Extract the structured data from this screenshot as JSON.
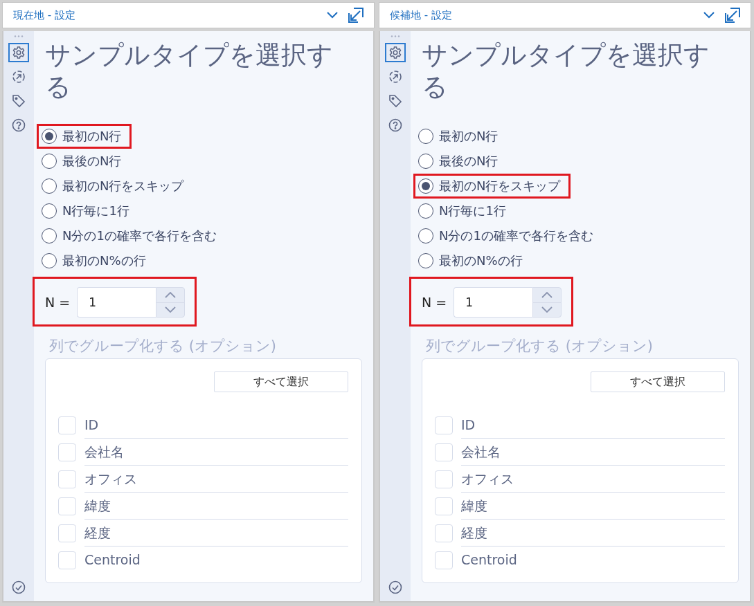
{
  "panels": [
    {
      "title": "現在地 - 設定",
      "tools": [
        {
          "kind": "settings",
          "selected": true
        },
        {
          "kind": "connection",
          "selected": false
        },
        {
          "kind": "tag",
          "selected": false
        },
        {
          "kind": "help",
          "selected": false
        }
      ],
      "heading": "サンプルタイプを選択する",
      "options": [
        {
          "label": "最初のN行",
          "selected": true,
          "highlighted": true
        },
        {
          "label": "最後のN行",
          "selected": false,
          "highlighted": false
        },
        {
          "label": "最初のN行をスキップ",
          "selected": false,
          "highlighted": false
        },
        {
          "label": "N行毎に1行",
          "selected": false,
          "highlighted": false
        },
        {
          "label": "N分の1の確率で各行を含む",
          "selected": false,
          "highlighted": false
        },
        {
          "label": "最初のN%の行",
          "selected": false,
          "highlighted": false
        }
      ],
      "n_field": {
        "label": "N =",
        "value": "1",
        "highlighted": true
      },
      "group_by": {
        "title": "列でグループ化する (オプション)",
        "select_all": "すべて選択",
        "columns": [
          {
            "label": "ID",
            "checked": false
          },
          {
            "label": "会社名",
            "checked": false
          },
          {
            "label": "オフィス",
            "checked": false
          },
          {
            "label": "緯度",
            "checked": false
          },
          {
            "label": "経度",
            "checked": false
          },
          {
            "label": "Centroid",
            "checked": false
          }
        ]
      }
    },
    {
      "title": "候補地 - 設定",
      "tools": [
        {
          "kind": "settings",
          "selected": true
        },
        {
          "kind": "connection",
          "selected": false
        },
        {
          "kind": "tag",
          "selected": false
        },
        {
          "kind": "help",
          "selected": false
        }
      ],
      "heading": "サンプルタイプを選択する",
      "options": [
        {
          "label": "最初のN行",
          "selected": false,
          "highlighted": false
        },
        {
          "label": "最後のN行",
          "selected": false,
          "highlighted": false
        },
        {
          "label": "最初のN行をスキップ",
          "selected": true,
          "highlighted": true
        },
        {
          "label": "N行毎に1行",
          "selected": false,
          "highlighted": false
        },
        {
          "label": "N分の1の確率で各行を含む",
          "selected": false,
          "highlighted": false
        },
        {
          "label": "最初のN%の行",
          "selected": false,
          "highlighted": false
        }
      ],
      "n_field": {
        "label": "N =",
        "value": "1",
        "highlighted": true
      },
      "group_by": {
        "title": "列でグループ化する (オプション)",
        "select_all": "すべて選択",
        "columns": [
          {
            "label": "ID",
            "checked": false
          },
          {
            "label": "会社名",
            "checked": false
          },
          {
            "label": "オフィス",
            "checked": false
          },
          {
            "label": "緯度",
            "checked": false
          },
          {
            "label": "経度",
            "checked": false
          },
          {
            "label": "Centroid",
            "checked": false
          }
        ]
      }
    }
  ]
}
